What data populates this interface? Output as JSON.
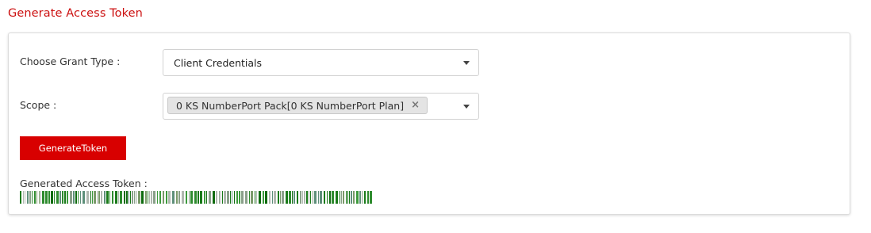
{
  "page": {
    "title": "Generate Access Token"
  },
  "form": {
    "grant_type_label": "Choose Grant Type :",
    "grant_type_value": "Client Credentials",
    "scope_label": "Scope :",
    "scope_tag": "0 KS NumberPort Pack[0 KS NumberPort Plan]",
    "scope_tag_remove": "×",
    "generate_button_label": "GenerateToken",
    "generated_token_label": "Generated Access Token :"
  },
  "colors": {
    "accent": "#cc1010",
    "button_bg": "#d80000",
    "token_green": "#1a7a1a"
  },
  "icons": {
    "dropdown": "caret-down-icon",
    "remove": "close-icon"
  }
}
